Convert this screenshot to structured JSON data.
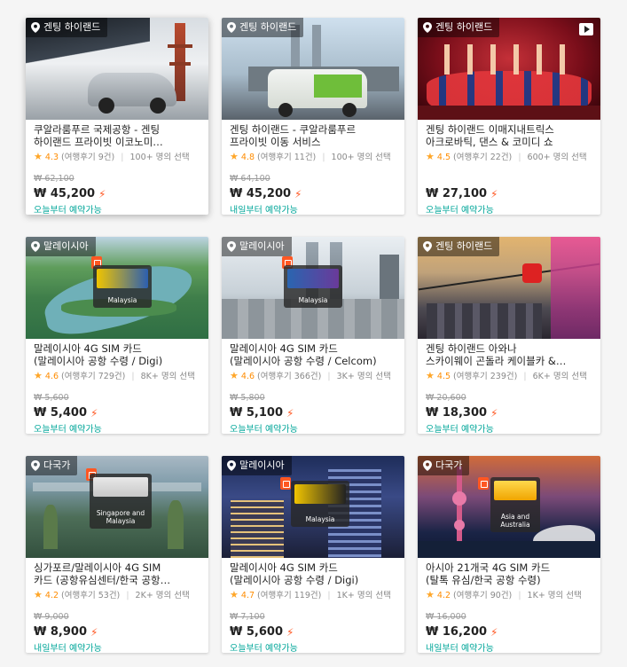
{
  "cards": [
    {
      "location": "겐팅 하이랜드",
      "title": "쿠알라룸푸르 국제공항 - 겐팅\n하이랜드 프라이빗 이코노미…",
      "score": "4.3",
      "reviews": "(여행후기 9건)",
      "selected": "100+ 명의 선택",
      "original_price": "₩ 62,100",
      "price": "₩ 45,200",
      "availability": "오늘부터 예약가능",
      "theme": "car",
      "has_video": false,
      "sim_label": ""
    },
    {
      "location": "겐팅 하이랜드",
      "title": "겐팅 하이랜드 - 쿠알라룸푸르\n프라이빗 이동 서비스",
      "score": "4.8",
      "reviews": "(여행후기 11건)",
      "selected": "100+ 명의 선택",
      "original_price": "₩ 64,100",
      "price": "₩ 45,200",
      "availability": "내일부터 예약가능",
      "theme": "van",
      "has_video": false,
      "sim_label": ""
    },
    {
      "location": "겐팅 하이랜드",
      "title": "겐팅 하이랜드 이매지내트릭스\n아크로바틱, 댄스 & 코미디 쇼",
      "score": "4.5",
      "reviews": "(여행후기 22건)",
      "selected": "600+ 명의 선택",
      "original_price": "",
      "price": "₩ 27,100",
      "availability": "오늘부터 예약가능",
      "theme": "show",
      "has_video": true,
      "sim_label": ""
    },
    {
      "location": "말레이시아",
      "title": "말레이시아 4G SIM 카드\n(말레이시아 공항 수령 / Digi)",
      "score": "4.6",
      "reviews": "(여행후기 729건)",
      "selected": "8K+ 명의 선택",
      "original_price": "₩ 5,600",
      "price": "₩ 5,400",
      "availability": "오늘부터 예약가능",
      "theme": "river",
      "has_video": false,
      "sim_label": "Malaysia"
    },
    {
      "location": "말레이시아",
      "title": "말레이시아 4G SIM 카드\n(말레이시아 공항 수령 / Celcom)",
      "score": "4.6",
      "reviews": "(여행후기 366건)",
      "selected": "3K+ 명의 선택",
      "original_price": "₩ 5,800",
      "price": "₩ 5,100",
      "availability": "오늘부터 예약가능",
      "theme": "towers",
      "has_video": false,
      "sim_label": "Malaysia"
    },
    {
      "location": "겐팅 하이랜드",
      "title": "겐팅 하이랜드 아와나\n스카이웨이 곤돌라 케이블카 &…",
      "score": "4.5",
      "reviews": "(여행후기 239건)",
      "selected": "6K+ 명의 선택",
      "original_price": "₩ 20,600",
      "price": "₩ 18,300",
      "availability": "오늘부터 예약가능",
      "theme": "gondola",
      "has_video": false,
      "sim_label": ""
    },
    {
      "location": "다국가",
      "title": "싱가포르/말레이시아 4G SIM\n카드 (공항유심센터/한국 공항…",
      "score": "4.2",
      "reviews": "(여행후기 53건)",
      "selected": "2K+ 명의 선택",
      "original_price": "₩ 9,000",
      "price": "₩ 8,900",
      "availability": "내일부터 예약가능",
      "theme": "garden",
      "has_video": false,
      "sim_label": "Singapore and Malaysia"
    },
    {
      "location": "말레이시아",
      "title": "말레이시아 4G SIM 카드\n(말레이시아 공항 수령 / Digi)",
      "score": "4.7",
      "reviews": "(여행후기 119건)",
      "selected": "1K+ 명의 선택",
      "original_price": "₩ 7,100",
      "price": "₩ 5,600",
      "availability": "오늘부터 예약가능",
      "theme": "night",
      "has_video": false,
      "sim_label": "Malaysia"
    },
    {
      "location": "다국가",
      "title": "아시아 21개국 4G SIM 카드\n(탈톡 유심/한국 공항 수령)",
      "score": "4.2",
      "reviews": "(여행후기 90건)",
      "selected": "1K+ 명의 선택",
      "original_price": "₩ 16,000",
      "price": "₩ 16,200",
      "availability": "내일부터 예약가능",
      "theme": "shanghai",
      "has_video": false,
      "sim_label": "Asia and Australia"
    }
  ],
  "icons": {
    "location": "location-pin-icon",
    "star": "star-icon",
    "instant": "lightning-bolt-icon",
    "video": "video-play-icon",
    "sim": "sim-card-tag-icon"
  },
  "colors": {
    "star": "#ffa628",
    "bolt": "#ff5722",
    "available": "#00a699"
  }
}
